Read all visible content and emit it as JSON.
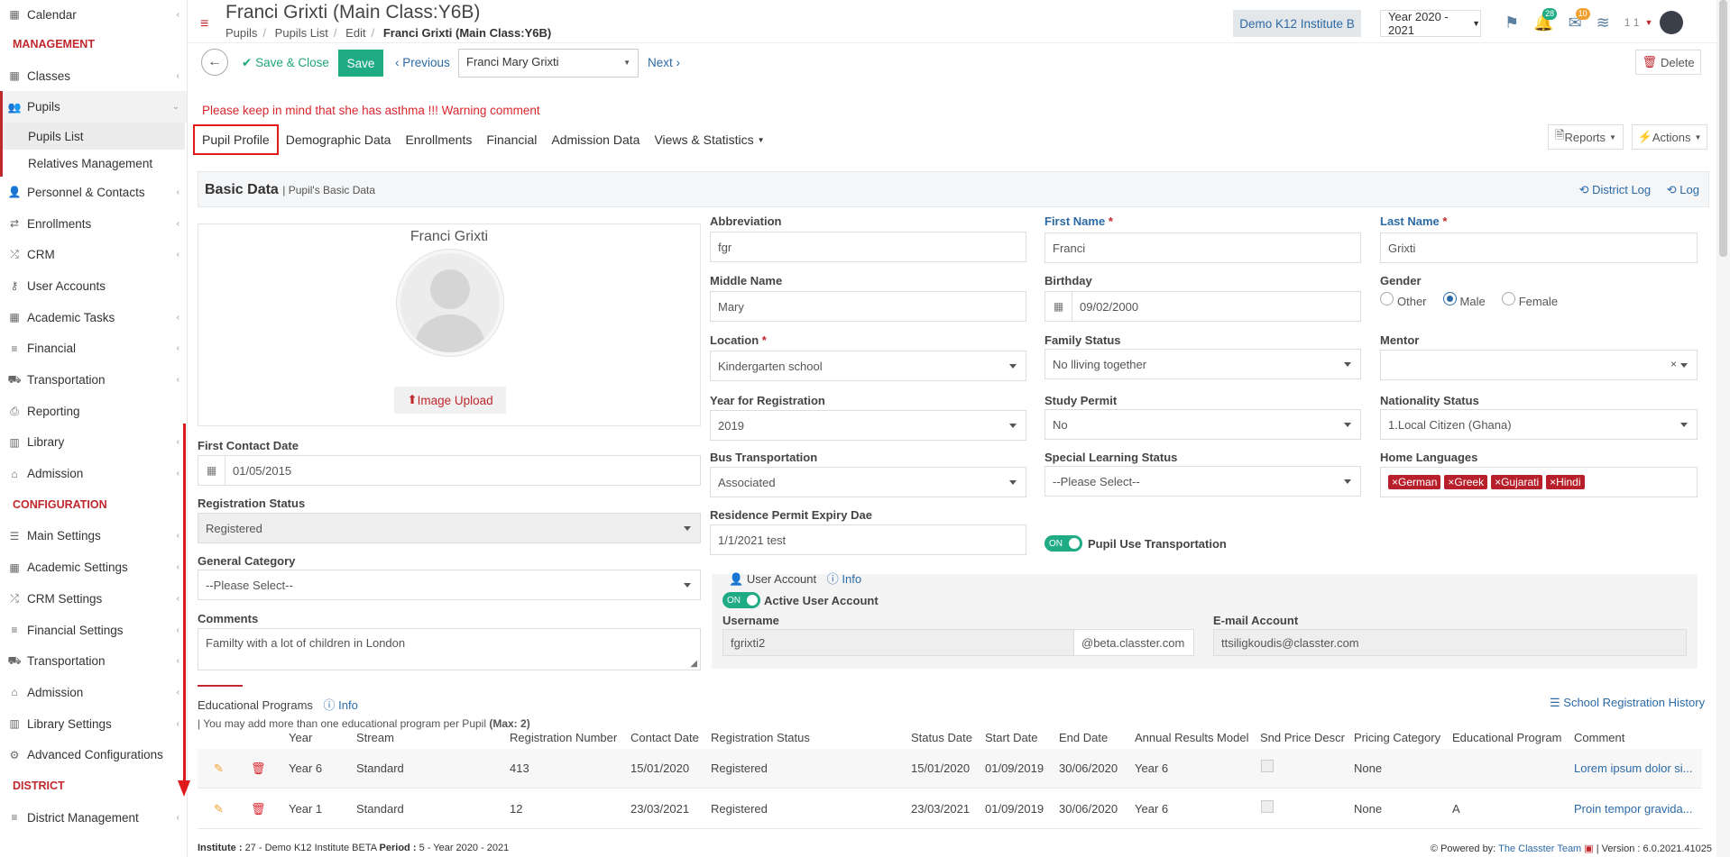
{
  "sidebar": {
    "items": [
      {
        "label": "Calendar",
        "icon": "calendar-icon"
      },
      {
        "section": "MANAGEMENT"
      },
      {
        "label": "Classes",
        "icon": "grid-icon"
      },
      {
        "label": "Pupils",
        "icon": "users-icon"
      },
      {
        "sub": "Pupils List"
      },
      {
        "sub": "Relatives Management"
      },
      {
        "label": "Personnel & Contacts",
        "icon": "user-tie-icon"
      },
      {
        "label": "Enrollments",
        "icon": "exchange-icon"
      },
      {
        "label": "CRM",
        "icon": "random-icon"
      },
      {
        "label": "User Accounts",
        "icon": "key-icon"
      },
      {
        "label": "Academic Tasks",
        "icon": "tasks-icon"
      },
      {
        "label": "Financial",
        "icon": "coins-icon"
      },
      {
        "label": "Transportation",
        "icon": "bus-icon"
      },
      {
        "label": "Reporting",
        "icon": "print-icon"
      },
      {
        "label": "Library",
        "icon": "books-icon"
      },
      {
        "label": "Admission",
        "icon": "institution-icon"
      },
      {
        "section": "CONFIGURATION"
      },
      {
        "label": "Main Settings",
        "icon": "sliders-icon"
      },
      {
        "label": "Academic Settings",
        "icon": "grid-icon"
      },
      {
        "label": "CRM Settings",
        "icon": "random-icon"
      },
      {
        "label": "Financial Settings",
        "icon": "coins-icon"
      },
      {
        "label": "Transportation",
        "icon": "bus-icon"
      },
      {
        "label": "Admission",
        "icon": "institution-icon"
      },
      {
        "label": "Library Settings",
        "icon": "books-icon"
      },
      {
        "label": "Advanced Configurations",
        "icon": "gears-icon"
      },
      {
        "section": "DISTRICT"
      },
      {
        "label": "District Management",
        "icon": "menu-icon"
      }
    ]
  },
  "header": {
    "title": "Franci Grixti (Main Class:Y6B)",
    "breadcrumb": [
      "Pupils",
      "Pupils List",
      "Edit",
      "Franci Grixti (Main Class:Y6B)"
    ],
    "institute": "Demo K12 Institute B",
    "year": "Year 2020 - 2021",
    "notif_count": "28",
    "msg_count": "10",
    "user_short": "1 1"
  },
  "toolbar": {
    "save_close": "Save & Close",
    "save": "Save",
    "previous": "Previous",
    "pupil_select": "Franci Mary Grixti",
    "next": "Next",
    "delete": "Delete"
  },
  "warning": "Please keep in mind that she has asthma !!! Warning comment",
  "tabs": [
    "Pupil Profile",
    "Demographic Data",
    "Enrollments",
    "Financial",
    "Admission Data",
    "Views & Statistics"
  ],
  "reports": "Reports",
  "actions": "Actions",
  "basic": {
    "title": "Basic Data",
    "subtitle": "| Pupil's Basic Data",
    "district_log": "District Log",
    "log": "Log",
    "photo_name": "Franci Grixti",
    "image_upload": "Image Upload"
  },
  "form": {
    "abbreviation_label": "Abbreviation",
    "abbreviation": "fgr",
    "first_name_label": "First Name",
    "first_name": "Franci",
    "last_name_label": "Last Name",
    "last_name": "Grixti",
    "middle_name_label": "Middle Name",
    "middle_name": "Mary",
    "birthday_label": "Birthday",
    "birthday": "09/02/2000",
    "gender_label": "Gender",
    "gender_other": "Other",
    "gender_male": "Male",
    "gender_female": "Female",
    "location_label": "Location",
    "location": "Kindergarten school",
    "family_status_label": "Family Status",
    "family_status": "No lliving together",
    "mentor_label": "Mentor",
    "year_reg_label": "Year for Registration",
    "year_reg": "2019",
    "study_permit_label": "Study Permit",
    "study_permit": "No",
    "nationality_label": "Nationality Status",
    "nationality": "1.Local Citizen (Ghana)",
    "bus_label": "Bus Transportation",
    "bus": "Associated",
    "special_label": "Special Learning Status",
    "special": "--Please Select--",
    "home_lang_label": "Home Languages",
    "home_langs": [
      "German",
      "Greek",
      "Gujarati",
      "Hindi"
    ],
    "residence_label": "Residence Permit Expiry Dae",
    "residence": "1/1/2021 test",
    "pupil_use_transport": "Pupil Use Transportation",
    "first_contact_label": "First Contact Date",
    "first_contact": "01/05/2015",
    "reg_status_label": "Registration Status",
    "reg_status": "Registered",
    "general_cat_label": "General Category",
    "general_cat": "--Please Select--",
    "comments_label": "Comments",
    "comments": "Familty with a lot of children in London",
    "toggle_on": "ON",
    "user_account": "User Account",
    "info": "Info",
    "active_user": "Active User Account",
    "username_label": "Username",
    "username": "fgrixti2",
    "username_domain": "@beta.classter.com",
    "email_label": "E-mail Account",
    "email": "ttsiligkoudis@classter.com"
  },
  "edu": {
    "title": "Educational Programs",
    "info": "Info",
    "note_prefix": "| You may add more than one educational program per Pupil",
    "note_max": "(Max: 2)",
    "history": "School Registration History",
    "columns": [
      "Year",
      "Stream",
      "Registration Number",
      "Contact Date",
      "Registration Status",
      "Status Date",
      "Start Date",
      "End Date",
      "Annual Results Model",
      "Snd Price Descr",
      "Pricing Category",
      "Educational Program",
      "Comment"
    ],
    "rows": [
      [
        "Year 6",
        "Standard",
        "413",
        "15/01/2020",
        "Registered",
        "15/01/2020",
        "01/09/2019",
        "30/06/2020",
        "Year 6",
        "",
        "None",
        "",
        "Lorem ipsum dolor si..."
      ],
      [
        "Year 1",
        "Standard",
        "12",
        "23/03/2021",
        "Registered",
        "23/03/2021",
        "01/09/2019",
        "30/06/2020",
        "Year 6",
        "",
        "None",
        "A",
        "Proin tempor gravida..."
      ]
    ]
  },
  "footer": {
    "institute_label": "Institute :",
    "institute": "27 - Demo K12 Institute BETA",
    "period_label": "Period :",
    "period": "5 - Year 2020 - 2021",
    "powered_by": "Powered by:",
    "team": "The Classter Team",
    "version": "| Version : 6.0.2021.41025"
  },
  "colors": {
    "brand_red": "#c0282d",
    "link_blue": "#2c6aa6",
    "save_green": "#1fab83"
  }
}
